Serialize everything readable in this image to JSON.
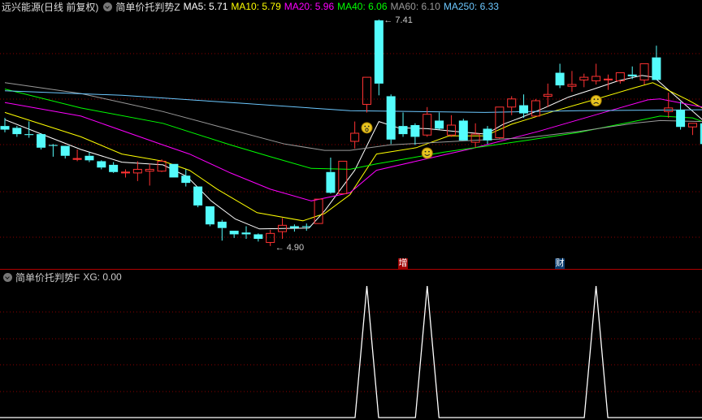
{
  "header": {
    "stock": "远兴能源(日线 前复权)",
    "indicator": "简单价托判势Z",
    "ma": [
      {
        "label": "MA5: 5.71",
        "color": "#ffffff"
      },
      {
        "label": "MA10: 5.79",
        "color": "#ffff00"
      },
      {
        "label": "MA20: 5.96",
        "color": "#ff00ff"
      },
      {
        "label": "MA40: 6.06",
        "color": "#00ff00"
      },
      {
        "label": "MA60: 6.10",
        "color": "#9a9a9a"
      },
      {
        "label": "MA250: 6.33",
        "color": "#6cc8ff"
      }
    ]
  },
  "colors": {
    "up": "#ff3232",
    "down": "#54fcfc",
    "grid": "#8b0000",
    "divider": "#b00000"
  },
  "chart_data": [
    {
      "type": "candlestick",
      "title": "简单价托判势Z",
      "ohlc": [
        [
          6.23,
          6.32,
          6.16,
          6.19
        ],
        [
          6.21,
          6.23,
          6.11,
          6.14
        ],
        [
          6.14,
          6.28,
          6.1,
          6.13
        ],
        [
          6.14,
          6.15,
          5.97,
          5.99
        ],
        [
          6.02,
          6.03,
          5.89,
          6.01
        ],
        [
          6.01,
          6.01,
          5.87,
          5.9
        ],
        [
          5.86,
          5.97,
          5.84,
          5.87
        ],
        [
          5.9,
          5.94,
          5.83,
          5.85
        ],
        [
          5.84,
          5.85,
          5.75,
          5.77
        ],
        [
          5.8,
          5.83,
          5.71,
          5.72
        ],
        [
          5.71,
          5.75,
          5.66,
          5.72
        ],
        [
          5.71,
          5.84,
          5.62,
          5.75
        ],
        [
          5.73,
          5.81,
          5.57,
          5.75
        ],
        [
          5.73,
          5.86,
          5.72,
          5.84
        ],
        [
          5.81,
          5.81,
          5.66,
          5.66
        ],
        [
          5.68,
          5.75,
          5.56,
          5.6
        ],
        [
          5.56,
          5.56,
          5.33,
          5.35
        ],
        [
          5.34,
          5.34,
          5.12,
          5.14
        ],
        [
          5.17,
          5.19,
          4.96,
          5.1
        ],
        [
          5.07,
          5.07,
          4.99,
          5.03
        ],
        [
          5.05,
          5.12,
          4.98,
          5.03
        ],
        [
          5.03,
          5.04,
          4.95,
          4.98
        ],
        [
          4.94,
          5.08,
          4.9,
          5.04
        ],
        [
          5.06,
          5.21,
          4.98,
          5.13
        ],
        [
          5.12,
          5.14,
          5.06,
          5.1
        ],
        [
          5.12,
          5.15,
          5.07,
          5.11
        ],
        [
          5.15,
          5.42,
          5.15,
          5.42
        ],
        [
          5.72,
          5.88,
          5.48,
          5.49
        ],
        [
          5.48,
          5.84,
          5.48,
          5.84
        ],
        [
          6.06,
          6.28,
          5.98,
          6.15
        ],
        [
          6.47,
          6.77,
          6.38,
          6.77
        ],
        [
          7.4,
          7.41,
          6.57,
          6.7
        ],
        [
          6.56,
          6.58,
          6.03,
          6.08
        ],
        [
          6.23,
          6.38,
          6.11,
          6.14
        ],
        [
          6.24,
          6.26,
          6.02,
          6.11
        ],
        [
          6.13,
          6.44,
          6.11,
          6.36
        ],
        [
          6.29,
          6.38,
          6.19,
          6.2
        ],
        [
          6.13,
          6.35,
          6.11,
          6.24
        ],
        [
          6.29,
          6.31,
          6.07,
          6.07
        ],
        [
          6.05,
          6.26,
          5.99,
          6.14
        ],
        [
          6.2,
          6.23,
          6.03,
          6.07
        ],
        [
          6.1,
          6.44,
          6.09,
          6.44
        ],
        [
          6.44,
          6.56,
          6.35,
          6.53
        ],
        [
          6.46,
          6.58,
          6.32,
          6.37
        ],
        [
          6.34,
          6.53,
          6.34,
          6.51
        ],
        [
          6.56,
          6.7,
          6.44,
          6.58
        ],
        [
          6.82,
          6.92,
          6.65,
          6.68
        ],
        [
          6.67,
          6.84,
          6.61,
          6.69
        ],
        [
          6.74,
          6.81,
          6.66,
          6.77
        ],
        [
          6.73,
          6.92,
          6.69,
          6.78
        ],
        [
          6.74,
          6.8,
          6.63,
          6.75
        ],
        [
          6.73,
          6.82,
          6.7,
          6.82
        ],
        [
          6.8,
          6.89,
          6.75,
          6.78
        ],
        [
          6.74,
          6.92,
          6.69,
          6.92
        ],
        [
          6.99,
          7.12,
          6.74,
          6.74
        ],
        [
          6.39,
          6.6,
          6.32,
          6.43
        ],
        [
          6.41,
          6.5,
          6.19,
          6.22
        ],
        [
          6.22,
          6.26,
          6.13,
          6.26
        ],
        [
          6.26,
          6.26,
          6.03,
          6.03
        ]
      ],
      "ylim": [
        4.85,
        7.45
      ],
      "ma_lines": [
        {
          "name": "MA5",
          "color": "#ffffff",
          "points": [
            [
              0,
              6.3
            ],
            [
              3.6,
              6.11
            ],
            [
              6.3,
              5.97
            ],
            [
              9.7,
              5.83
            ],
            [
              13.1,
              5.8
            ],
            [
              15.1,
              5.67
            ],
            [
              17.1,
              5.4
            ],
            [
              19.1,
              5.2
            ],
            [
              21.1,
              5.09
            ],
            [
              25.2,
              5.1
            ],
            [
              26.5,
              5.29
            ],
            [
              29,
              5.74
            ],
            [
              31,
              6.28
            ],
            [
              32.6,
              6.21
            ],
            [
              35,
              6.2
            ],
            [
              37.3,
              6.17
            ],
            [
              39.9,
              6.14
            ],
            [
              41.3,
              6.25
            ],
            [
              42.7,
              6.32
            ],
            [
              44.7,
              6.43
            ],
            [
              46.7,
              6.55
            ],
            [
              48.8,
              6.64
            ],
            [
              50.8,
              6.73
            ],
            [
              52.8,
              6.79
            ],
            [
              53.8,
              6.77
            ],
            [
              55.5,
              6.57
            ],
            [
              57.8,
              6.3
            ]
          ]
        },
        {
          "name": "MA10",
          "color": "#ffff00",
          "points": [
            [
              0,
              6.38
            ],
            [
              6.3,
              6.11
            ],
            [
              9.7,
              5.92
            ],
            [
              13.1,
              5.84
            ],
            [
              15.3,
              5.74
            ],
            [
              17.6,
              5.53
            ],
            [
              20.9,
              5.27
            ],
            [
              24.7,
              5.18
            ],
            [
              26.5,
              5.26
            ],
            [
              28.6,
              5.47
            ],
            [
              30.8,
              5.92
            ],
            [
              34.1,
              5.99
            ],
            [
              36.8,
              6.12
            ],
            [
              39.8,
              6.12
            ],
            [
              42,
              6.25
            ],
            [
              45.4,
              6.39
            ],
            [
              48.8,
              6.52
            ],
            [
              52.1,
              6.65
            ],
            [
              53.7,
              6.71
            ],
            [
              56.6,
              6.52
            ],
            [
              57.8,
              6.43
            ]
          ]
        },
        {
          "name": "MA20",
          "color": "#ff00ff",
          "points": [
            [
              0,
              6.49
            ],
            [
              6.3,
              6.34
            ],
            [
              13.1,
              6.02
            ],
            [
              15.3,
              5.92
            ],
            [
              18.7,
              5.71
            ],
            [
              22,
              5.53
            ],
            [
              25.4,
              5.4
            ],
            [
              28.6,
              5.49
            ],
            [
              30.8,
              5.74
            ],
            [
              34.1,
              5.84
            ],
            [
              38.7,
              5.98
            ],
            [
              44.2,
              6.17
            ],
            [
              49.9,
              6.39
            ],
            [
              53.3,
              6.52
            ],
            [
              54.3,
              6.53
            ],
            [
              57.8,
              6.44
            ]
          ]
        },
        {
          "name": "MA40",
          "color": "#00ff00",
          "points": [
            [
              0,
              6.64
            ],
            [
              6.3,
              6.43
            ],
            [
              13.1,
              6.26
            ],
            [
              18.7,
              6.02
            ],
            [
              22,
              5.89
            ],
            [
              25.4,
              5.76
            ],
            [
              28.6,
              5.75
            ],
            [
              30.8,
              5.81
            ],
            [
              36.4,
              5.94
            ],
            [
              43.2,
              6.07
            ],
            [
              47.6,
              6.16
            ],
            [
              52.1,
              6.28
            ],
            [
              54.3,
              6.34
            ],
            [
              57,
              6.32
            ],
            [
              57.8,
              6.28
            ]
          ]
        },
        {
          "name": "MA60",
          "color": "#9a9a9a",
          "points": [
            [
              0,
              6.71
            ],
            [
              6.3,
              6.59
            ],
            [
              13.1,
              6.39
            ],
            [
              18.7,
              6.19
            ],
            [
              23.2,
              6.03
            ],
            [
              26.5,
              5.96
            ],
            [
              28.6,
              5.96
            ],
            [
              31.9,
              6.02
            ],
            [
              38.7,
              6.07
            ],
            [
              43.2,
              6.1
            ],
            [
              47.6,
              6.17
            ],
            [
              52.1,
              6.26
            ],
            [
              54.3,
              6.29
            ],
            [
              57.8,
              6.28
            ]
          ]
        },
        {
          "name": "MA250",
          "color": "#6cc8ff",
          "points": [
            [
              0,
              6.62
            ],
            [
              9.7,
              6.57
            ],
            [
              19.8,
              6.48
            ],
            [
              28.6,
              6.4
            ],
            [
              39.8,
              6.38
            ],
            [
              47.6,
              6.4
            ],
            [
              57.8,
              6.41
            ]
          ]
        }
      ],
      "annotations": [
        {
          "index": 31,
          "price": 7.41,
          "text": "7.41"
        },
        {
          "index": 22,
          "price": 4.9,
          "text": "4.90"
        }
      ],
      "faces": [
        {
          "index": 30,
          "price": 6.21,
          "type": "surprised"
        },
        {
          "index": 35,
          "price": 5.93,
          "type": "smile"
        },
        {
          "index": 49,
          "price": 6.51,
          "type": "sad"
        }
      ],
      "signal_tags": [
        {
          "index": 33,
          "text": "增",
          "bg": "#a00000"
        },
        {
          "index": 46,
          "text": "财",
          "bg": "#0a3c6e"
        }
      ]
    },
    {
      "type": "line",
      "title": "简单价托判势F",
      "value_label": "XG: 0.00",
      "signal_indices": [
        30,
        35,
        49
      ],
      "ylim": [
        0,
        1
      ],
      "color": "#ffffff"
    }
  ]
}
